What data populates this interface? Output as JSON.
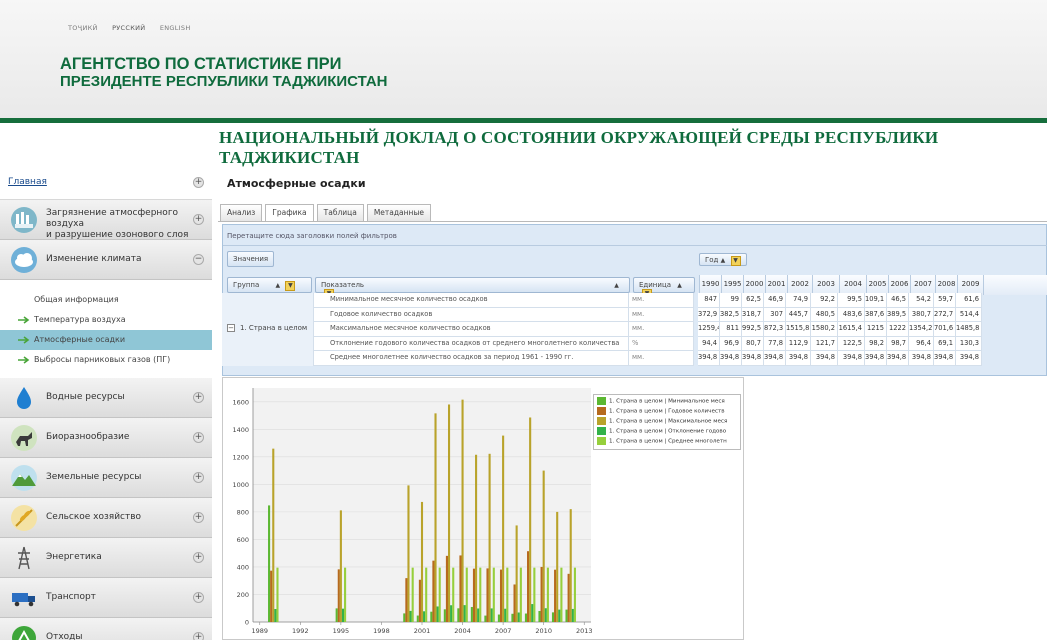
{
  "header": {
    "languages": [
      "ТОҶИКӢ",
      "РУССКИЙ",
      "ENGLISH"
    ],
    "agency_line1": "АГЕНТСТВО ПО СТАТИСТИКЕ ПРИ",
    "agency_line2": "ПРЕЗИДЕНТЕ РЕСПУБЛИКИ ТАДЖИКИСТАН",
    "banner": "НАЦИОНАЛЬНЫЙ ДОКЛАД О СОСТОЯНИИ ОКРУЖАЮЩЕЙ СРЕДЫ РЕСПУБЛИКИ ТАДЖИКИСТАН",
    "accent_color": "#0f6b3d"
  },
  "sidebar": {
    "home": "Главная",
    "cat_ozone": "Загрязнение атмосферного воздуха и разрушение озонового слоя",
    "cat_ozone_l1": "Загрязнение атмосферного воздуха",
    "cat_ozone_l2": "и разрушение озонового слоя",
    "cat_climate": "Изменение климата",
    "sub_general": "Общая информация",
    "sub_temperature": "Температура воздуха",
    "sub_precip": "Атмосферные осадки",
    "sub_emissions": "Выбросы парниковых газов (ПГ)",
    "cat_water": "Водные ресурсы",
    "cat_bio": "Биоразнообразие",
    "cat_land": "Земельные ресурсы",
    "cat_agri": "Сельское хозяйство",
    "cat_energy": "Энергетика",
    "cat_transport": "Транспорт",
    "cat_waste": "Отходы"
  },
  "main": {
    "title": "Атмосферные осадки",
    "tabs": [
      "Анализ",
      "Графика",
      "Таблица",
      "Метаданные"
    ],
    "active_tab": "Графика",
    "filter_hint": "Перетащите сюда заголовки полей фильтров",
    "values_button": "Значения",
    "year_button": "Год",
    "col_group": "Группа",
    "col_indicator": "Показатель",
    "col_unit": "Единица",
    "years": [
      "1990",
      "1995",
      "2000",
      "2001",
      "2002",
      "2003",
      "2004",
      "2005",
      "2006",
      "2007",
      "2008",
      "2009"
    ],
    "group_label": "1. Страна в целом",
    "rows": [
      {
        "indicator": "Минимальное месячное количество осадков",
        "unit": "мм.",
        "values": [
          "847",
          "99",
          "62,5",
          "46,9",
          "74,9",
          "92,2",
          "99,5",
          "109,1",
          "46,5",
          "54,2",
          "59,7",
          "61,6"
        ]
      },
      {
        "indicator": "Годовое количество осадков",
        "unit": "мм.",
        "values": [
          "372,9",
          "382,5",
          "318,7",
          "307",
          "445,7",
          "480,5",
          "483,6",
          "387,6",
          "389,5",
          "380,7",
          "272,7",
          "514,4"
        ]
      },
      {
        "indicator": "Максимальное месячное количество осадков",
        "unit": "мм.",
        "values": [
          "1259,4",
          "811",
          "992,5",
          "872,3",
          "1515,8",
          "1580,2",
          "1615,4",
          "1215",
          "1222",
          "1354,2",
          "701,6",
          "1485,8"
        ]
      },
      {
        "indicator": "Отклонение годового количества осадков от среднего многолетнего количества",
        "unit": "%",
        "values": [
          "94,4",
          "96,9",
          "80,7",
          "77,8",
          "112,9",
          "121,7",
          "122,5",
          "98,2",
          "98,7",
          "96,4",
          "69,1",
          "130,3"
        ]
      },
      {
        "indicator": "Среднее многолетнее количество осадков за период 1961 - 1990 гг.",
        "unit": "мм.",
        "values": [
          "394,8",
          "394,8",
          "394,8",
          "394,8",
          "394,8",
          "394,8",
          "394,8",
          "394,8",
          "394,8",
          "394,8",
          "394,8",
          "394,8"
        ]
      }
    ]
  },
  "chart_data": {
    "type": "bar",
    "x_tick_labels": [
      "1989",
      "1992",
      "1995",
      "1998",
      "2001",
      "2004",
      "2007",
      "2010",
      "2013"
    ],
    "y_tick_labels": [
      "0",
      "200",
      "400",
      "600",
      "800",
      "1000",
      "1200",
      "1400",
      "1600"
    ],
    "ylim": [
      0,
      1700
    ],
    "xlim": [
      1988.5,
      2013.5
    ],
    "grid": true,
    "legend_position": "top-right",
    "legend": [
      "1. Страна в целом | Минимальное меся",
      "1. Страна в целом | Годовое количеств",
      "1. Страна в целом | Максимальное меся",
      "1. Страна в целом | Отклонение годово",
      "1. Страна в целом | Среднее многолетн"
    ],
    "series": [
      {
        "color": "#5cb832",
        "values": [
          847,
          99,
          62.5,
          46.9,
          74.9,
          92.2,
          99.5,
          109.1,
          46.5,
          54.2,
          59.7,
          61.6,
          80,
          70,
          90
        ]
      },
      {
        "color": "#b66a1e",
        "values": [
          372.9,
          382.5,
          318.7,
          307,
          445.7,
          480.5,
          483.6,
          387.6,
          389.5,
          380.7,
          272.7,
          514.4,
          400,
          380,
          350
        ]
      },
      {
        "color": "#b9a32b",
        "values": [
          1259.4,
          811,
          992.5,
          872.3,
          1515.8,
          1580.2,
          1615.4,
          1215,
          1222,
          1354.2,
          701.6,
          1485.8,
          1100,
          800,
          820
        ]
      },
      {
        "color": "#33b24a",
        "values": [
          94.4,
          96.9,
          80.7,
          77.8,
          112.9,
          121.7,
          122.5,
          98.2,
          98.7,
          96.4,
          69.1,
          130.3,
          100,
          90,
          95
        ]
      },
      {
        "color": "#96cf3c",
        "values": [
          394.8,
          394.8,
          394.8,
          394.8,
          394.8,
          394.8,
          394.8,
          394.8,
          394.8,
          394.8,
          394.8,
          394.8,
          394.8,
          394.8,
          394.8
        ]
      }
    ],
    "x": [
      1990,
      1995,
      2000,
      2001,
      2002,
      2003,
      2004,
      2005,
      2006,
      2007,
      2008,
      2009,
      2010,
      2011,
      2012
    ]
  }
}
